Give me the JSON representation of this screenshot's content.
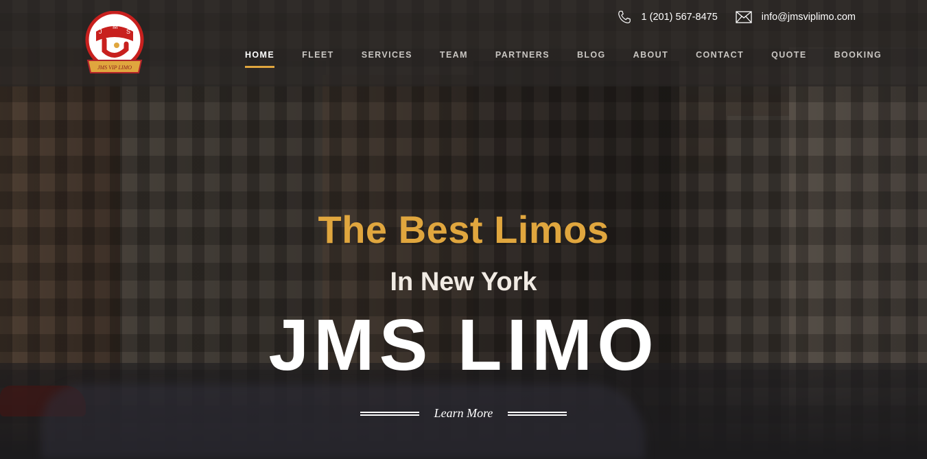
{
  "header": {
    "logo": {
      "letters": [
        "J",
        "M",
        "S"
      ],
      "ribbon_text": "JMS VIP LIMO"
    },
    "phone": "1 (201) 567-8475",
    "email": "info@jmsviplimo.com",
    "icons": {
      "phone": "phone-icon",
      "email": "envelope-icon"
    }
  },
  "nav": {
    "items": [
      {
        "label": "HOME",
        "active": true
      },
      {
        "label": "FLEET"
      },
      {
        "label": "SERVICES"
      },
      {
        "label": "TEAM"
      },
      {
        "label": "PARTNERS"
      },
      {
        "label": "BLOG"
      },
      {
        "label": "ABOUT"
      },
      {
        "label": "CONTACT"
      },
      {
        "label": "QUOTE"
      },
      {
        "label": "BOOKING"
      }
    ]
  },
  "hero": {
    "headline": "The Best Limos",
    "subheadline": "In New York",
    "brand": "JMS LIMO",
    "cta": "Learn More"
  },
  "colors": {
    "accent": "#e0a63e",
    "header_bg": "rgba(40,38,36,0.72)",
    "text": "#ffffff"
  }
}
